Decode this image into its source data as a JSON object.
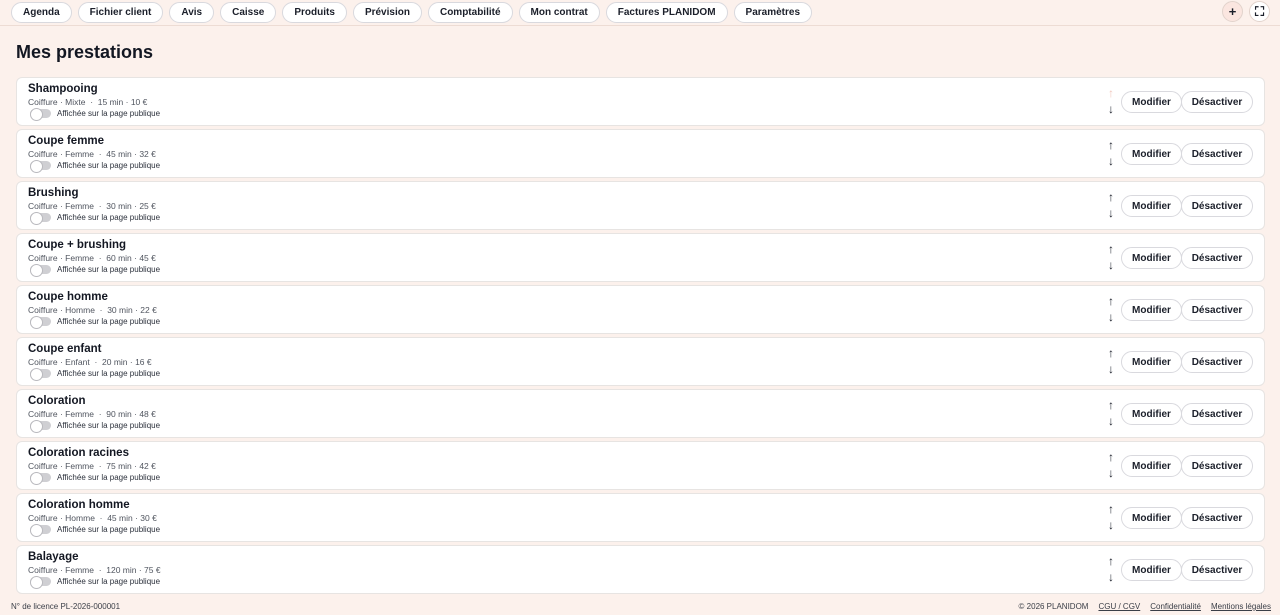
{
  "nav": [
    {
      "label": "Agenda"
    },
    {
      "label": "Fichier client"
    },
    {
      "label": "Avis"
    },
    {
      "label": "Caisse"
    },
    {
      "label": "Produits"
    },
    {
      "label": "Prévision"
    },
    {
      "label": "Comptabilité"
    },
    {
      "label": "Mon contrat"
    },
    {
      "label": "Factures PLANIDOM"
    },
    {
      "label": "Paramètres"
    }
  ],
  "top_icons": {
    "add": "+",
    "fullscreen": "⛶"
  },
  "page": {
    "title": "Mes prestations"
  },
  "common": {
    "toggle_label": "Affichée sur la page publique",
    "modify_label": "Modifier",
    "deactivate_label": "Désactiver",
    "up_arrow": "↑",
    "down_arrow": "↓"
  },
  "services": [
    {
      "name": "Shampooing",
      "meta": "Coiffure · Mixte  ·  15 min · 10 €",
      "up_disabled": true
    },
    {
      "name": "Coupe femme",
      "meta": "Coiffure · Femme  ·  45 min · 32 €"
    },
    {
      "name": "Brushing",
      "meta": "Coiffure · Femme  ·  30 min · 25 €"
    },
    {
      "name": "Coupe + brushing",
      "meta": "Coiffure · Femme  ·  60 min · 45 €"
    },
    {
      "name": "Coupe homme",
      "meta": "Coiffure · Homme  ·  30 min · 22 €"
    },
    {
      "name": "Coupe enfant",
      "meta": "Coiffure · Enfant  ·  20 min · 16 €"
    },
    {
      "name": "Coloration",
      "meta": "Coiffure · Femme  ·  90 min · 48 €"
    },
    {
      "name": "Coloration racines",
      "meta": "Coiffure · Femme  ·  75 min · 42 €"
    },
    {
      "name": "Coloration homme",
      "meta": "Coiffure · Homme  ·  45 min · 30 €"
    },
    {
      "name": "Balayage",
      "meta": "Coiffure · Femme  ·  120 min · 75 €"
    }
  ],
  "footer": {
    "license": "N° de licence PL-2026-000001",
    "copyright": "© 2026 PLANIDOM",
    "cgu": "CGU / CGV",
    "privacy": "Confidentialité",
    "legal": "Mentions légales"
  },
  "colors": {
    "background": "#fcf1ec",
    "card": "#ffffff",
    "text": "#1b1f2a",
    "disabled_arrow": "#f1c8bd"
  }
}
